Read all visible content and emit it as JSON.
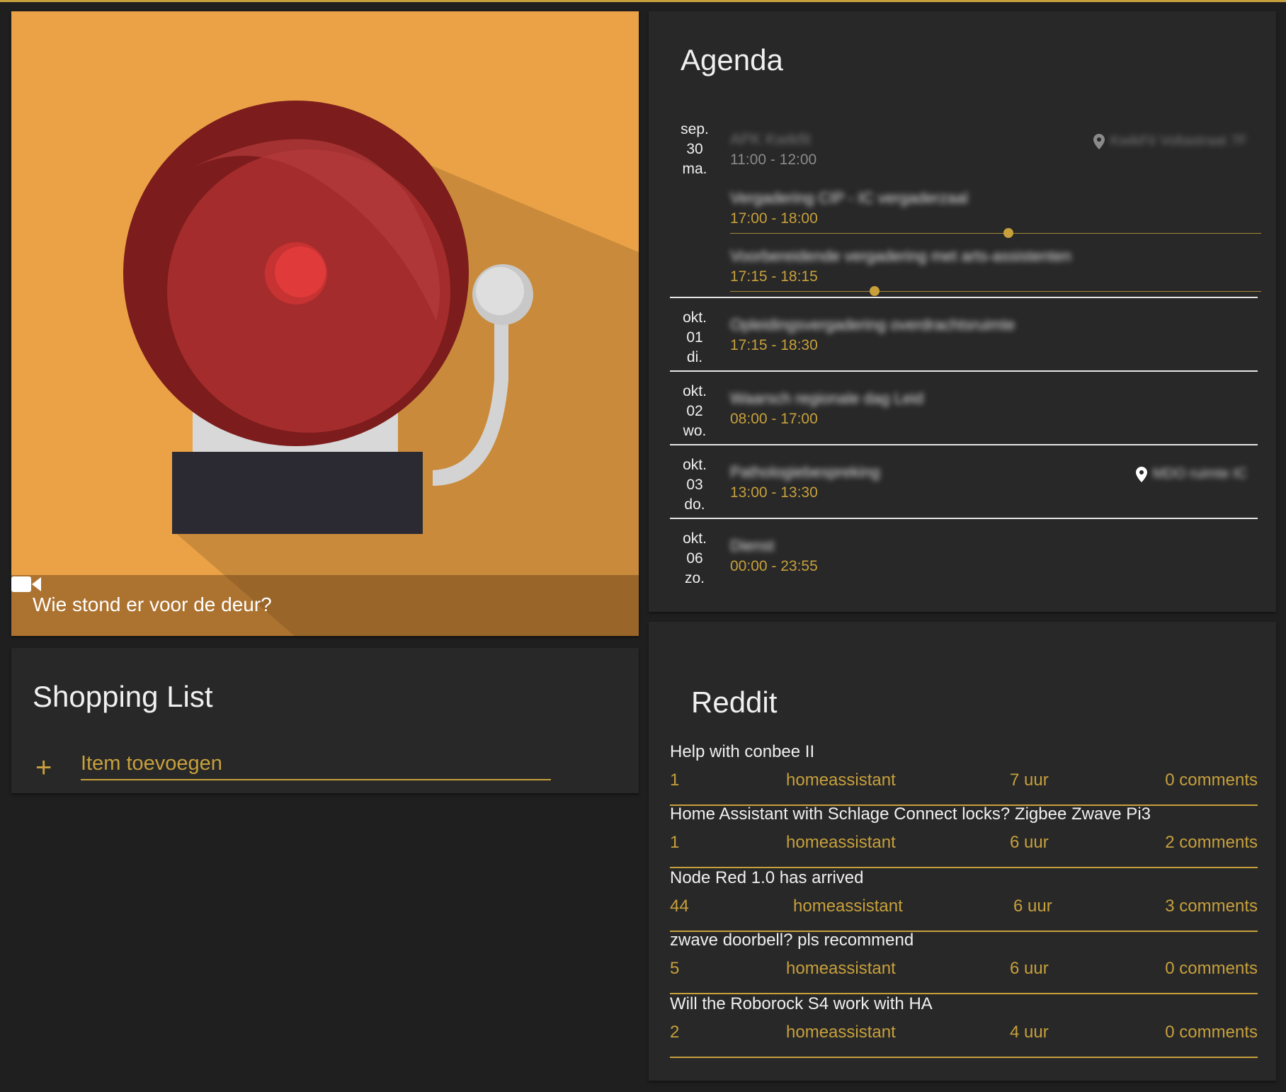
{
  "colors": {
    "accent": "#c7a03c",
    "card_bg": "#282828",
    "page_bg": "#1f1f1f",
    "cam_bg": "#eba246"
  },
  "camera": {
    "title": "Wie stond er voor de deur?",
    "icon": "video-camera-icon"
  },
  "shopping": {
    "title": "Shopping List",
    "add_icon": "plus-icon",
    "placeholder": "Item toevoegen"
  },
  "agenda": {
    "title": "Agenda",
    "days": [
      {
        "month": "sep.",
        "day": "30",
        "weekday": "ma.",
        "events": [
          {
            "title": "APK Kwikfit",
            "time": "11:00 - 12:00",
            "location": "KwikFit Voltastraat 7F",
            "past": true
          },
          {
            "title": "Vergadering CIP - IC vergaderzaal",
            "time": "17:00 - 18:00",
            "past": false
          },
          {
            "title": "Voorbereidende vergadering met arts-assistenten",
            "time": "17:15 - 18:15",
            "past": false
          }
        ]
      },
      {
        "month": "okt.",
        "day": "01",
        "weekday": "di.",
        "events": [
          {
            "title": "Opleidingsvergadering overdrachtsruimte",
            "time": "17:15 - 18:30"
          }
        ]
      },
      {
        "month": "okt.",
        "day": "02",
        "weekday": "wo.",
        "events": [
          {
            "title": "Waarsch regionale dag Leid",
            "time": "08:00 - 17:00"
          }
        ]
      },
      {
        "month": "okt.",
        "day": "03",
        "weekday": "do.",
        "events": [
          {
            "title": "Pathologiebespreking",
            "time": "13:00 - 13:30",
            "location": "MDO ruimte IC"
          }
        ]
      },
      {
        "month": "okt.",
        "day": "06",
        "weekday": "zo.",
        "events": [
          {
            "title": "Dienst",
            "time": "00:00 - 23:55"
          }
        ]
      }
    ]
  },
  "reddit": {
    "title": "Reddit",
    "posts": [
      {
        "title": "Help with conbee II",
        "score": "1",
        "sub": "homeassistant",
        "age": "7 uur",
        "comments": "0 comments"
      },
      {
        "title": "Home Assistant with Schlage Connect locks? Zigbee Zwave Pi3",
        "score": "1",
        "sub": "homeassistant",
        "age": "6 uur",
        "comments": "2 comments"
      },
      {
        "title": "Node Red 1.0 has arrived",
        "score": "44",
        "sub": "homeassistant",
        "age": "6 uur",
        "comments": "3 comments"
      },
      {
        "title": "zwave doorbell? pls recommend",
        "score": "5",
        "sub": "homeassistant",
        "age": "6 uur",
        "comments": "0 comments"
      },
      {
        "title": "Will the Roborock S4 work with HA",
        "score": "2",
        "sub": "homeassistant",
        "age": "4 uur",
        "comments": "0 comments"
      }
    ]
  }
}
